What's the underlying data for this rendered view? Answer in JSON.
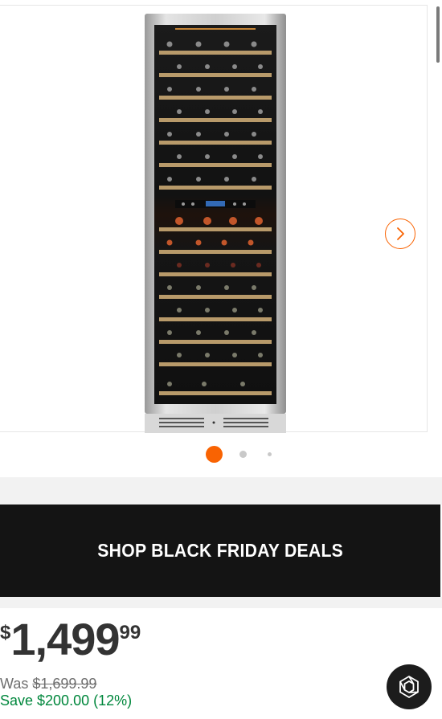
{
  "product_image": {
    "icon": "wine-cooler-image"
  },
  "carousel": {
    "next_icon": "chevron-right-icon",
    "active_index": 1,
    "dot_count": 3,
    "accent_color": "#f96302"
  },
  "promo": {
    "label": "SHOP BLACK FRIDAY DEALS"
  },
  "pricing": {
    "currency": "$",
    "dollars": "1,499",
    "cents": "99",
    "was_label": "Was",
    "was_price": "$1,699.99",
    "save_text": "Save $200.00 (12%)",
    "save_color": "#00873c"
  },
  "assistant": {
    "icon": "ai-assistant-icon"
  }
}
